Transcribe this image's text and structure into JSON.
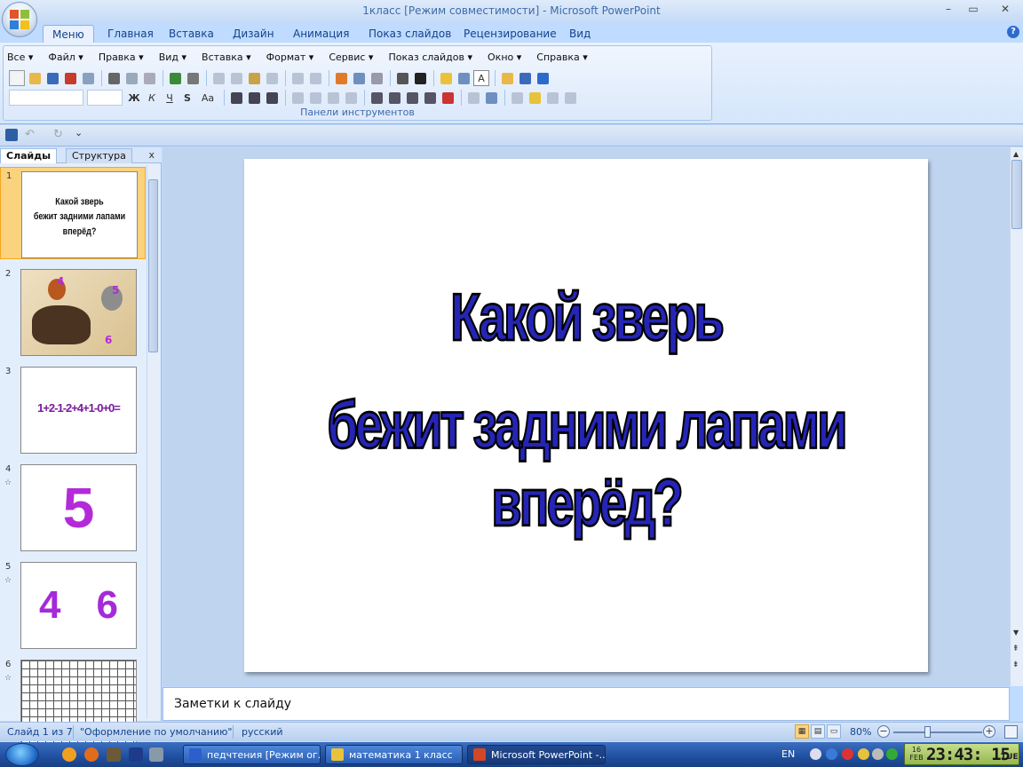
{
  "window": {
    "title": "1класс [Режим совместимости] - Microsoft PowerPoint",
    "minimize": "–",
    "restore": "▭",
    "close": "✕"
  },
  "ribbon_tabs": [
    "Меню",
    "Главная",
    "Вставка",
    "Дизайн",
    "Анимация",
    "Показ слайдов",
    "Рецензирование",
    "Вид"
  ],
  "menu_bar": [
    "Все ▾",
    "Файл ▾",
    "Правка ▾",
    "Вид ▾",
    "Вставка ▾",
    "Формат ▾",
    "Сервис ▾",
    "Показ слайдов ▾",
    "Окно ▾",
    "Справка ▾"
  ],
  "format_buttons": [
    "Ж",
    "К",
    "Ч",
    "S",
    "Aa"
  ],
  "group_label": "Панели инструментов",
  "slide_panel": {
    "tab_slides": "Слайды",
    "tab_outline": "Структура",
    "close": "x",
    "numbers": [
      "1",
      "2",
      "3",
      "4",
      "5",
      "6"
    ],
    "anim_mark": "☆",
    "thumb1_line1": "Какой зверь",
    "thumb1_line2": "бежит задними лапами вперёд?",
    "thumb2_tags": [
      "4",
      "5",
      "6"
    ],
    "thumb3_text": "1+2-1-2+4+1-0+0=",
    "thumb4_text": "5",
    "thumb5_left": "4",
    "thumb5_right": "6"
  },
  "slide": {
    "line1": "Какой зверь",
    "line2": "бежит задними лапами вперёд?"
  },
  "notes_placeholder": "Заметки к слайду",
  "status": {
    "slide_pos": "Слайд 1 из 7",
    "theme": "\"Оформление по умолчанию\"",
    "language": "русский",
    "zoom": "80%",
    "zoom_minus": "−",
    "zoom_plus": "+"
  },
  "taskbar": {
    "tasks": [
      "педчтения [Режим ог...",
      "математика 1 класс",
      "Microsoft PowerPoint -..."
    ],
    "lang": "EN",
    "date_day": "16",
    "date_month": "FEB",
    "time": "23:43: 15",
    "weekday": "TUE"
  },
  "colors": {
    "title_fill": "#2525b5",
    "accent": "#15428b"
  }
}
